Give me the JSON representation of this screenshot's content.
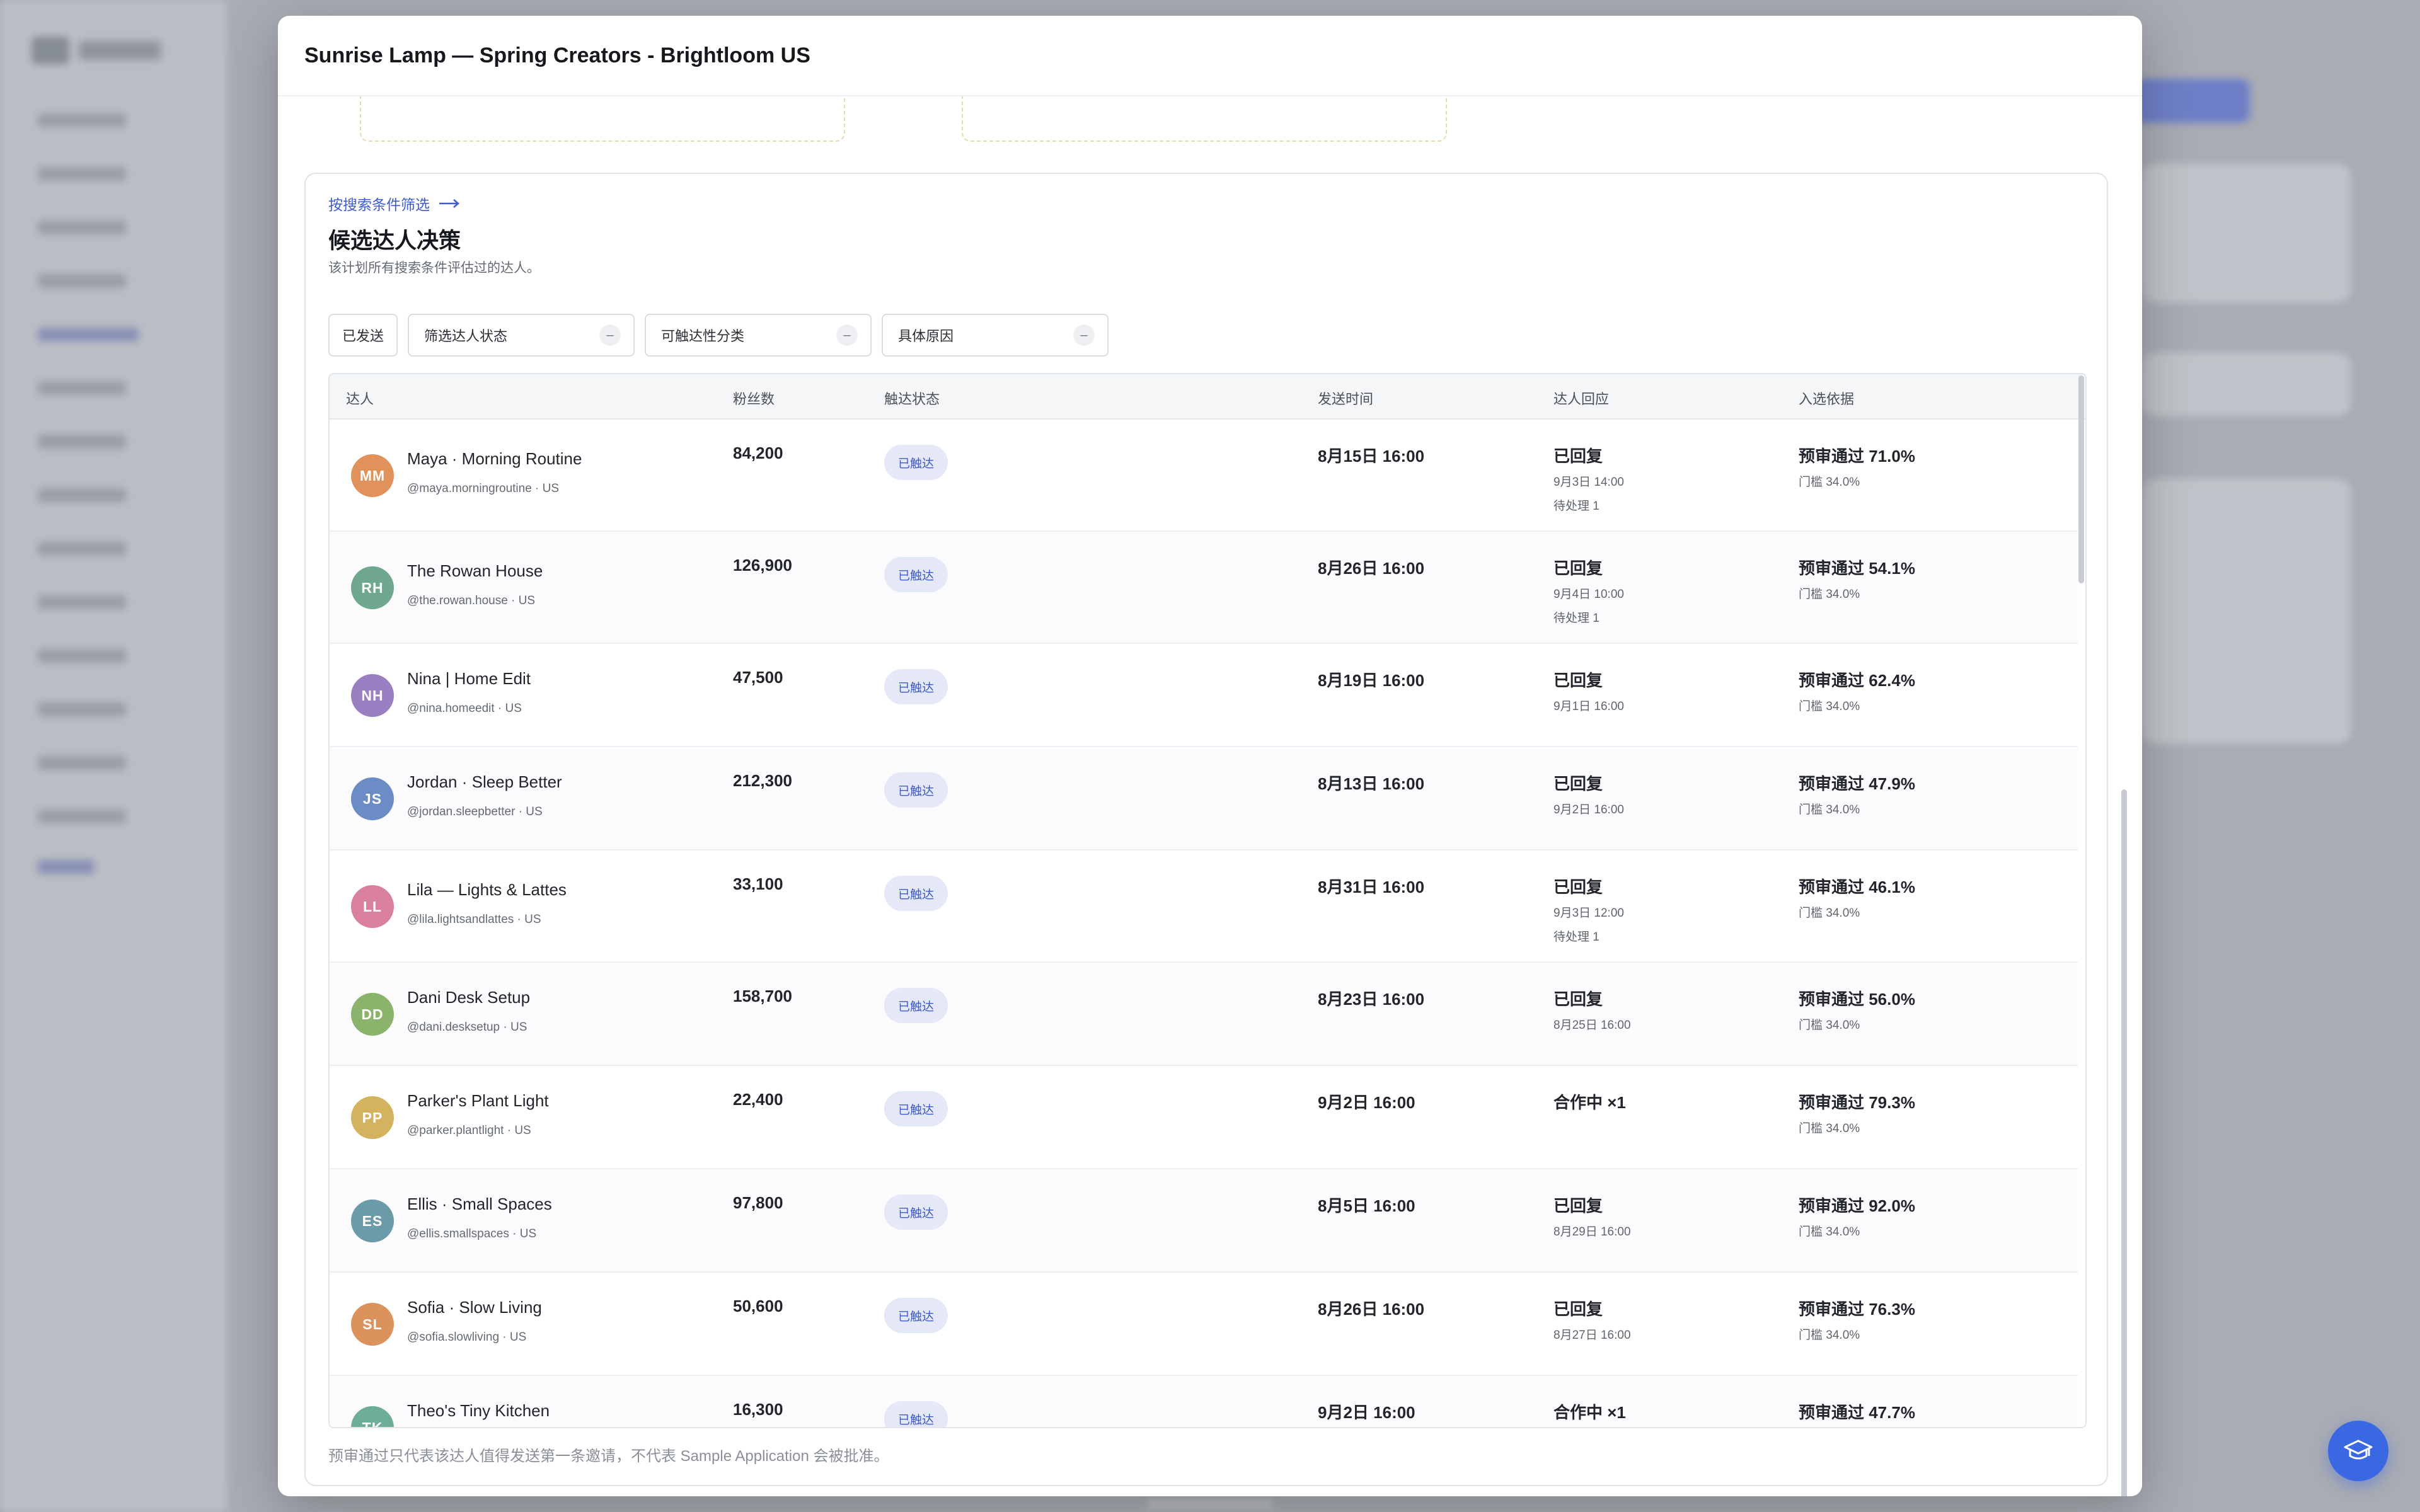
{
  "modal": {
    "title": "Sunrise Lamp — Spring Creators - Brightloom US"
  },
  "panel": {
    "link_label": "按搜索条件筛选",
    "title": "候选达人决策",
    "description": "该计划所有搜索条件评估过的达人。"
  },
  "filters": {
    "sent_label": "已发送",
    "selects": [
      {
        "label": "筛选达人状态",
        "clear": "–"
      },
      {
        "label": "可触达性分类",
        "clear": "–"
      },
      {
        "label": "具体原因",
        "clear": "–"
      }
    ]
  },
  "table": {
    "headers": [
      "达人",
      "粉丝数",
      "触达状态",
      "发送时间",
      "达人回应",
      "入选依据"
    ],
    "rows": [
      {
        "initials": "MM",
        "color": "#e0925a",
        "name": "Maya · Morning Routine",
        "handle": "@maya.morningroutine · US",
        "followers": "84,200",
        "status": "已触达",
        "sent": "8月15日 16:00",
        "reply": "已回复",
        "reply_time": "9月3日 14:00",
        "pending": "待处理 1",
        "basis": "预审通过 71.0%",
        "threshold": "门槛 34.0%"
      },
      {
        "initials": "RH",
        "color": "#6fa88e",
        "name": "The Rowan House",
        "handle": "@the.rowan.house · US",
        "followers": "126,900",
        "status": "已触达",
        "sent": "8月26日 16:00",
        "reply": "已回复",
        "reply_time": "9月4日 10:00",
        "pending": "待处理 1",
        "basis": "预审通过 54.1%",
        "threshold": "门槛 34.0%"
      },
      {
        "initials": "NH",
        "color": "#9a7fc2",
        "name": "Nina | Home Edit",
        "handle": "@nina.homeedit · US",
        "followers": "47,500",
        "status": "已触达",
        "sent": "8月19日 16:00",
        "reply": "已回复",
        "reply_time": "9月1日 16:00",
        "pending": "",
        "basis": "预审通过 62.4%",
        "threshold": "门槛 34.0%"
      },
      {
        "initials": "JS",
        "color": "#6b8cc4",
        "name": "Jordan · Sleep Better",
        "handle": "@jordan.sleepbetter · US",
        "followers": "212,300",
        "status": "已触达",
        "sent": "8月13日 16:00",
        "reply": "已回复",
        "reply_time": "9月2日 16:00",
        "pending": "",
        "basis": "预审通过 47.9%",
        "threshold": "门槛 34.0%"
      },
      {
        "initials": "LL",
        "color": "#d97f9f",
        "name": "Lila — Lights & Lattes",
        "handle": "@lila.lightsandlattes · US",
        "followers": "33,100",
        "status": "已触达",
        "sent": "8月31日 16:00",
        "reply": "已回复",
        "reply_time": "9月3日 12:00",
        "pending": "待处理 1",
        "basis": "预审通过 46.1%",
        "threshold": "门槛 34.0%"
      },
      {
        "initials": "DD",
        "color": "#8cb36c",
        "name": "Dani Desk Setup",
        "handle": "@dani.desksetup · US",
        "followers": "158,700",
        "status": "已触达",
        "sent": "8月23日 16:00",
        "reply": "已回复",
        "reply_time": "8月25日 16:00",
        "pending": "",
        "basis": "预审通过 56.0%",
        "threshold": "门槛 34.0%"
      },
      {
        "initials": "PP",
        "color": "#d4b35e",
        "name": "Parker's Plant Light",
        "handle": "@parker.plantlight · US",
        "followers": "22,400",
        "status": "已触达",
        "sent": "9月2日 16:00",
        "reply": "合作中 ×1",
        "reply_time": "",
        "pending": "",
        "basis": "预审通过 79.3%",
        "threshold": "门槛 34.0%"
      },
      {
        "initials": "ES",
        "color": "#6b9aa8",
        "name": "Ellis · Small Spaces",
        "handle": "@ellis.smallspaces · US",
        "followers": "97,800",
        "status": "已触达",
        "sent": "8月5日 16:00",
        "reply": "已回复",
        "reply_time": "8月29日 16:00",
        "pending": "",
        "basis": "预审通过 92.0%",
        "threshold": "门槛 34.0%"
      },
      {
        "initials": "SL",
        "color": "#dc925c",
        "name": "Sofia · Slow Living",
        "handle": "@sofia.slowliving · US",
        "followers": "50,600",
        "status": "已触达",
        "sent": "8月26日 16:00",
        "reply": "已回复",
        "reply_time": "8月27日 16:00",
        "pending": "",
        "basis": "预审通过 76.3%",
        "threshold": "门槛 34.0%"
      },
      {
        "initials": "TK",
        "color": "#6fae96",
        "name": "Theo's Tiny Kitchen",
        "handle": "",
        "followers": "16,300",
        "status": "已触达",
        "sent": "9月2日 16:00",
        "reply": "合作中 ×1",
        "reply_time": "",
        "pending": "",
        "basis": "预审通过 47.7%",
        "threshold": ""
      }
    ]
  },
  "footnote": "预审通过只代表该达人值得发送第一条邀请，不代表 Sample Application 会被批准。",
  "colors": {
    "accent": "#3d5ccf",
    "help_button": "#3a68e3",
    "status_chip_bg": "#e4e8f7"
  },
  "icons": {
    "help": "graduation-cap-icon",
    "link_arrow": "arrow-right-icon",
    "clear": "minus-icon"
  }
}
